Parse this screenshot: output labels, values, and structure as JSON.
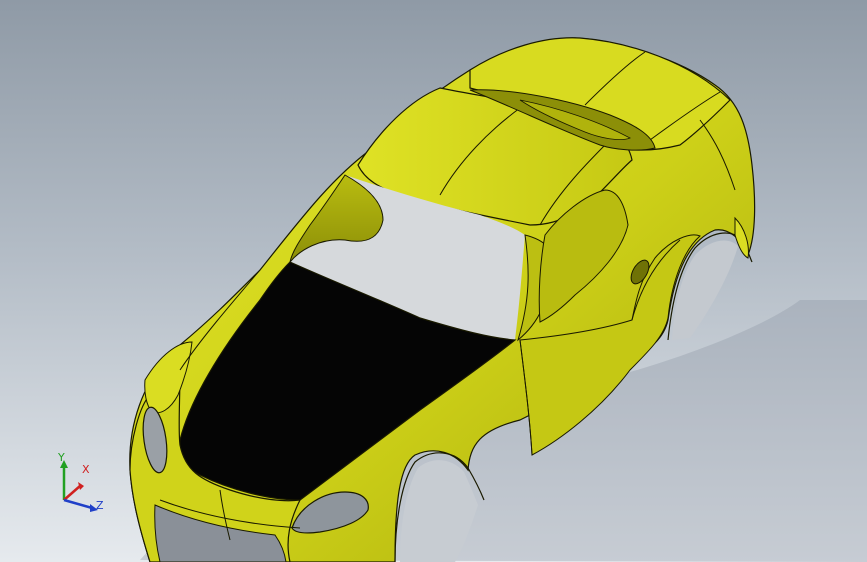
{
  "viewport": {
    "background_top": "#8f9aa6",
    "background_bottom": "#e6eaee"
  },
  "model": {
    "body_color": "#d3d61a",
    "body_shadow": "#a8ab0e",
    "glass_color": "#000000",
    "edge_color": "#1a1a00"
  },
  "triad": {
    "x_label": "X",
    "y_label": "Y",
    "z_label": "Z",
    "x_color": "#d02020",
    "y_color": "#22a022",
    "z_color": "#2040c8"
  }
}
